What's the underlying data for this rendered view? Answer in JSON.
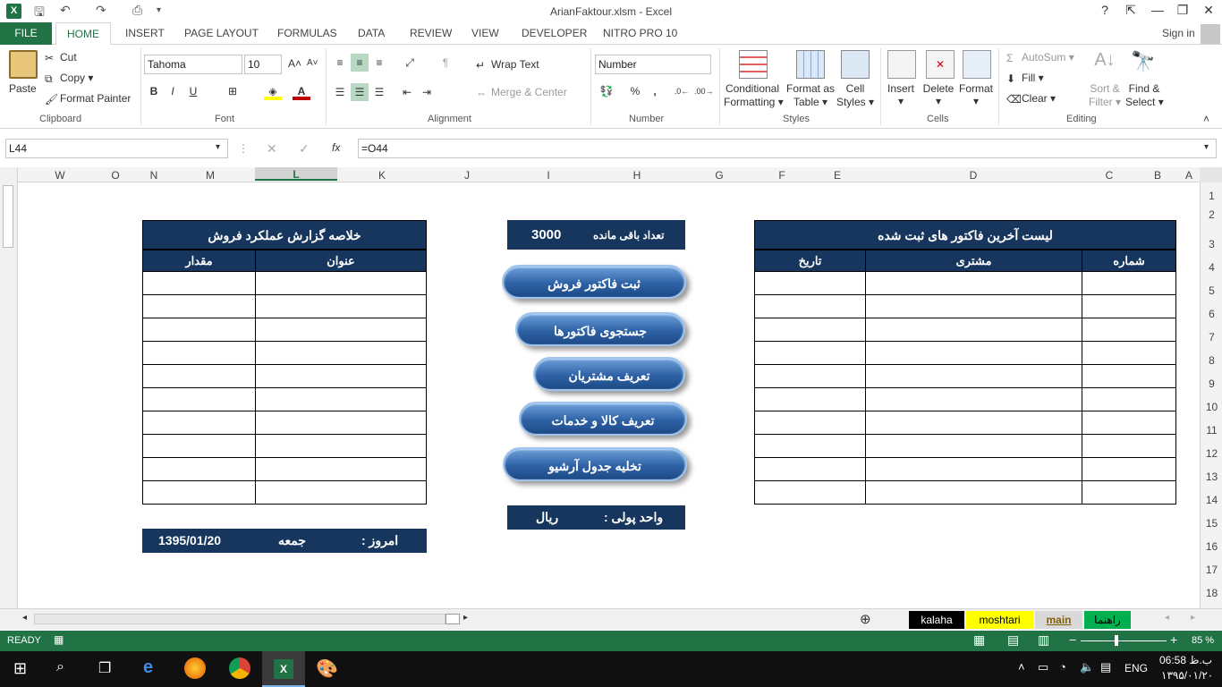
{
  "window": {
    "title": "ArianFaktour.xlsm - Excel",
    "help": "?",
    "min": "—",
    "max": "❐",
    "close": "✕"
  },
  "tabs": {
    "file": "FILE",
    "home": "HOME",
    "items": [
      "INSERT",
      "PAGE LAYOUT",
      "FORMULAS",
      "DATA",
      "REVIEW",
      "VIEW",
      "DEVELOPER",
      "NITRO PRO 10"
    ],
    "signin": "Sign in"
  },
  "ribbon": {
    "clipboard": {
      "paste": "Paste",
      "cut": "Cut",
      "copy": "Copy",
      "format_painter": "Format Painter",
      "label": "Clipboard"
    },
    "font": {
      "name": "Tahoma",
      "size": "10",
      "bold": "B",
      "italic": "I",
      "underline": "U",
      "label": "Font"
    },
    "alignment": {
      "wrap": "Wrap Text",
      "merge": "Merge & Center",
      "label": "Alignment"
    },
    "number": {
      "format": "Number",
      "percent": "%",
      "comma": ",",
      "label": "Number"
    },
    "styles": {
      "cond1": "Conditional",
      "cond2": "Formatting",
      "fmt1": "Format as",
      "fmt2": "Table",
      "cell1": "Cell",
      "cell2": "Styles",
      "label": "Styles"
    },
    "cells": {
      "insert": "Insert",
      "delete": "Delete",
      "format": "Format",
      "label": "Cells"
    },
    "editing": {
      "autosum": "AutoSum",
      "fill": "Fill",
      "clear": "Clear",
      "sort1": "Sort &",
      "sort2": "Filter",
      "find1": "Find &",
      "find2": "Select",
      "label": "Editing"
    }
  },
  "formula_bar": {
    "name_box": "L44",
    "fx": "fx",
    "formula": "=O44"
  },
  "columns": [
    "W",
    "O",
    "N",
    "M",
    "L",
    "K",
    "J",
    "I",
    "H",
    "G",
    "F",
    "E",
    "D",
    "C",
    "B",
    "A"
  ],
  "rows": [
    "1",
    "2",
    "3",
    "4",
    "5",
    "6",
    "7",
    "8",
    "9",
    "10",
    "11",
    "12",
    "13",
    "14",
    "15",
    "16",
    "17",
    "18"
  ],
  "sheet": {
    "summary": {
      "title": "خلاصه گزارش عملکرد فروش",
      "col_amount": "مقدار",
      "col_title": "عنوان"
    },
    "date_bar": {
      "label": "امروز :",
      "day": "جمعه",
      "date": "1395/01/20"
    },
    "remaining": {
      "label": "تعداد باقی مانده",
      "value": "3000"
    },
    "buttons": [
      "ثبت فاکتور فروش",
      "جستجوی فاکتورها",
      "تعریف مشتریان",
      "تعریف کالا و خدمات",
      "تخلیه جدول آرشیو"
    ],
    "currency": {
      "label": "واحد پولی :",
      "value": "ریال"
    },
    "invoices": {
      "title": "لیست آخرین فاکتور های ثبت شده",
      "col_date": "تاریخ",
      "col_customer": "مشتری",
      "col_number": "شماره"
    }
  },
  "sheet_tabs": [
    {
      "name": "kalaha",
      "bg": "#000000",
      "fg": "#ffffff"
    },
    {
      "name": "moshtari",
      "bg": "#ffff00",
      "fg": "#000000"
    },
    {
      "name": "main",
      "bg": "#d9d9d9",
      "fg": "#7f6000"
    },
    {
      "name": "راهنما",
      "bg": "#00b050",
      "fg": "#000000"
    }
  ],
  "status": {
    "ready": "READY",
    "zoom": "85 %"
  },
  "taskbar": {
    "time": "06:58 ب.ظ",
    "date": "۱۳۹۵/۰۱/۲۰",
    "lang": "ENG"
  },
  "colors": {
    "excel_green": "#217346",
    "navy": "#17365d"
  }
}
